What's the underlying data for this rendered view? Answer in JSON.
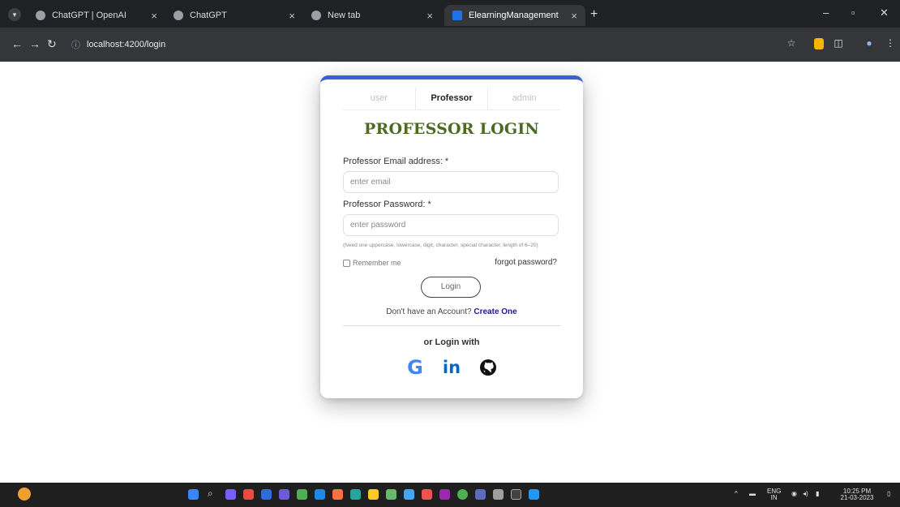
{
  "browser": {
    "tabs": [
      {
        "title": "ChatGPT | OpenAI"
      },
      {
        "title": "ChatGPT"
      },
      {
        "title": "New tab"
      },
      {
        "title": "ElearningManagement"
      }
    ],
    "url": "localhost:4200/login"
  },
  "login": {
    "role_tabs": [
      "user",
      "Professor",
      "admin"
    ],
    "active_tab": "Professor",
    "title": "PROFESSOR LOGIN",
    "email_label": "Professor Email address: *",
    "email_placeholder": "enter email",
    "password_label": "Professor Password: *",
    "password_placeholder": "enter password",
    "password_hint": "(Need one uppercase, lowercase, digit, character, special character, length of 6–20)",
    "remember_label": "Remember me",
    "forgot_label": "forgot password?",
    "login_button": "Login",
    "signup_text": "Don't have an Account?",
    "signup_link": "Create One",
    "or_login_with": "or Login with",
    "social": [
      "google-icon",
      "linkedin-icon",
      "github-icon"
    ]
  },
  "taskbar": {
    "lang": "ENG",
    "lang_sub": "IN",
    "time": "10:25 PM",
    "date": "21-03-2023"
  },
  "colors": {
    "accent": "#3d5fd6",
    "title": "#4c6a24",
    "google": "#4285f4",
    "linkedin": "#0a66c2"
  }
}
